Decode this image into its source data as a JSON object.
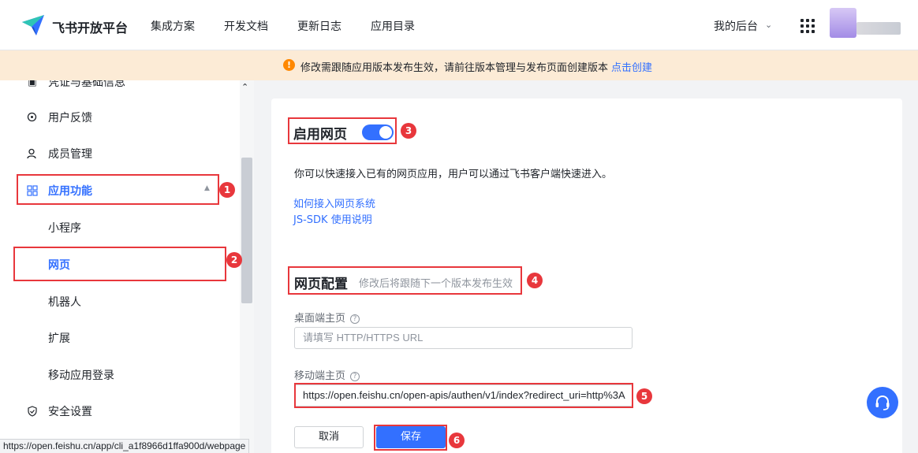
{
  "brand": "飞书开放平台",
  "nav": {
    "links": [
      "集成方案",
      "开发文档",
      "更新日志",
      "应用目录"
    ],
    "my_backend": "我的后台"
  },
  "notice": {
    "text": "修改需跟随应用版本发布生效，请前往版本管理与发布页面创建版本",
    "link": "点击创建"
  },
  "sidebar": {
    "partial_item": "凭证与基础信息",
    "items": [
      {
        "label": "用户反馈",
        "icon": "feedback-icon"
      },
      {
        "label": "成员管理",
        "icon": "member-icon"
      },
      {
        "label": "应用功能",
        "icon": "apps-grid-icon"
      }
    ],
    "sub_items": [
      "小程序",
      "网页",
      "机器人",
      "扩展",
      "移动应用登录"
    ],
    "security": {
      "label": "安全设置",
      "icon": "shield-icon"
    }
  },
  "web": {
    "enable_title": "启用网页",
    "toggle_on": true,
    "description": "你可以快速接入已有的网页应用，用户可以通过飞书客户端快速进入。",
    "links": [
      "如何接入网页系统",
      "JS-SDK 使用说明"
    ],
    "config_title": "网页配置",
    "config_subtitle": "修改后将跟随下一个版本发布生效",
    "desktop_label": "桌面端主页",
    "desktop_placeholder": "请填写 HTTP/HTTPS URL",
    "mobile_label": "移动端主页",
    "mobile_value": "https://open.feishu.cn/open-apis/authen/v1/index?redirect_uri=http%3A",
    "cancel": "取消",
    "save": "保存"
  },
  "badges": [
    "1",
    "2",
    "3",
    "4",
    "5",
    "6"
  ],
  "status_url": "https://open.feishu.cn/app/cli_a1f8966d1ffa900d/webpage",
  "colors": {
    "accent": "#3370ff",
    "annotation": "#e8373c",
    "notice_bg": "#fcebd6",
    "warning": "#ff8800"
  }
}
